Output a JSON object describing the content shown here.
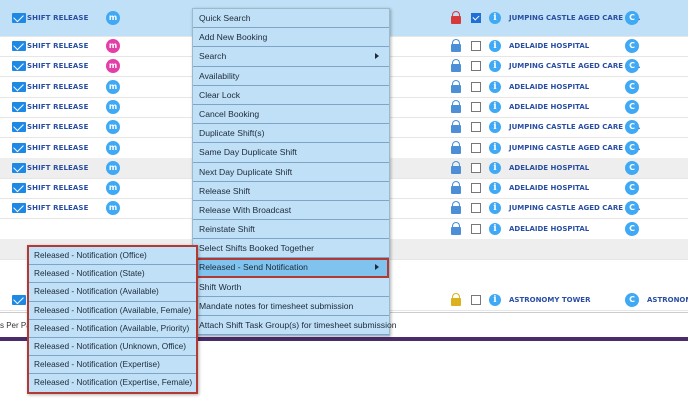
{
  "rows": [
    {
      "type": "SHIFT RELEASE",
      "badge": "m",
      "badge_color": "#3fa9f5",
      "lock": "red",
      "checked": true,
      "location": "JUMPING CASTLE AGED CARE M...",
      "c": "C",
      "extra": ""
    },
    {
      "type": "SHIFT RELEASE",
      "badge": "m",
      "badge_color": "#e33fa8",
      "lock": "blue",
      "checked": false,
      "location": "ADELAIDE HOSPITAL",
      "c": "C",
      "extra": ""
    },
    {
      "type": "SHIFT RELEASE",
      "badge": "m",
      "badge_color": "#e33fa8",
      "lock": "blue",
      "checked": false,
      "location": "JUMPING CASTLE AGED CARE M...",
      "c": "C",
      "extra": ""
    },
    {
      "type": "SHIFT RELEASE",
      "badge": "m",
      "badge_color": "#3fa9f5",
      "lock": "blue",
      "checked": false,
      "location": "ADELAIDE HOSPITAL",
      "c": "C",
      "extra": ""
    },
    {
      "type": "SHIFT RELEASE",
      "badge": "m",
      "badge_color": "#3fa9f5",
      "lock": "blue",
      "checked": false,
      "location": "ADELAIDE HOSPITAL",
      "c": "C",
      "extra": ""
    },
    {
      "type": "SHIFT RELEASE",
      "badge": "m",
      "badge_color": "#3fa9f5",
      "lock": "blue",
      "checked": false,
      "location": "JUMPING CASTLE AGED CARE M...",
      "c": "C",
      "extra": ""
    },
    {
      "type": "SHIFT RELEASE",
      "badge": "m",
      "badge_color": "#3fa9f5",
      "lock": "blue",
      "checked": false,
      "location": "JUMPING CASTLE AGED CARE M...",
      "c": "C",
      "extra": ""
    },
    {
      "type": "SHIFT RELEASE",
      "badge": "m",
      "badge_color": "#3fa9f5",
      "lock": "blue",
      "checked": false,
      "location": "ADELAIDE HOSPITAL",
      "c": "C",
      "extra": ""
    },
    {
      "type": "SHIFT RELEASE",
      "badge": "m",
      "badge_color": "#3fa9f5",
      "lock": "blue",
      "checked": false,
      "location": "ADELAIDE HOSPITAL",
      "c": "C",
      "extra": ""
    },
    {
      "type": "SHIFT RELEASE",
      "badge": "m",
      "badge_color": "#3fa9f5",
      "lock": "blue",
      "checked": false,
      "location": "JUMPING CASTLE AGED CARE M...",
      "c": "C",
      "extra": ""
    },
    {
      "type": "",
      "badge": "",
      "badge_color": "#3fa9f5",
      "lock": "blue",
      "checked": false,
      "location": "ADELAIDE HOSPITAL",
      "c": "C",
      "extra": ""
    },
    {
      "type": "",
      "badge": "",
      "badge_color": "",
      "lock": "",
      "checked": false,
      "location": "",
      "c": "",
      "extra": ""
    },
    {
      "type": "",
      "badge": "",
      "badge_color": "",
      "lock": "gold",
      "checked": false,
      "location": "ASTRONOMY TOWER",
      "c": "C",
      "extra": "ASTRONOMY"
    }
  ],
  "footer": {
    "text": "s Per Pag"
  },
  "context_menu": {
    "items": [
      {
        "label": "Quick Search",
        "submenu": false,
        "highlight": false
      },
      {
        "label": "Add New Booking",
        "submenu": false,
        "highlight": false
      },
      {
        "label": "Search",
        "submenu": true,
        "highlight": false
      },
      {
        "label": "Availability",
        "submenu": false,
        "highlight": false
      },
      {
        "label": "Clear Lock",
        "submenu": false,
        "highlight": false
      },
      {
        "label": "Cancel Booking",
        "submenu": false,
        "highlight": false
      },
      {
        "label": "Duplicate Shift(s)",
        "submenu": false,
        "highlight": false
      },
      {
        "label": "Same Day Duplicate Shift",
        "submenu": false,
        "highlight": false
      },
      {
        "label": "Next Day Duplicate Shift",
        "submenu": false,
        "highlight": false
      },
      {
        "label": "Release Shift",
        "submenu": false,
        "highlight": false
      },
      {
        "label": "Release With Broadcast",
        "submenu": false,
        "highlight": false
      },
      {
        "label": "Reinstate Shift",
        "submenu": false,
        "highlight": false
      },
      {
        "label": "Select Shifts Booked Together",
        "submenu": false,
        "highlight": false
      },
      {
        "label": "Released - Send Notification",
        "submenu": true,
        "highlight": true
      },
      {
        "label": "Shift Worth",
        "submenu": false,
        "highlight": false
      },
      {
        "label": "Mandate notes for timesheet submission",
        "submenu": false,
        "highlight": false
      },
      {
        "label": "Attach Shift Task Group(s) for timesheet submission",
        "submenu": false,
        "highlight": false
      }
    ]
  },
  "submenu": {
    "items": [
      "Released - Notification (Office)",
      "Released - Notification (State)",
      "Released - Notification (Available)",
      "Released - Notification (Available, Female)",
      "Released - Notification (Available, Priority)",
      "Released - Notification (Unknown, Office)",
      "Released - Notification (Expertise)",
      "Released - Notification (Expertise, Female)"
    ]
  }
}
